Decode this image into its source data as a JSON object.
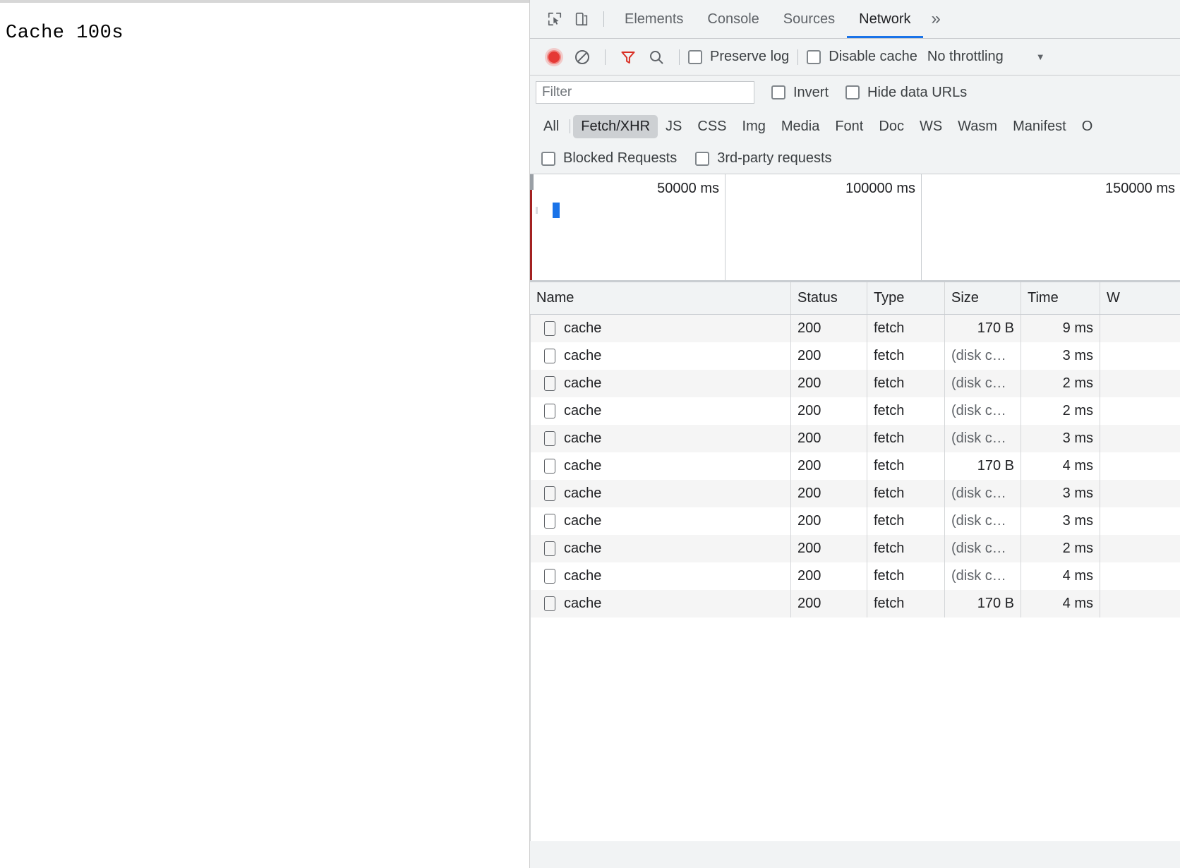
{
  "page": {
    "heading": "Cache 100s"
  },
  "devtools": {
    "tabs": [
      {
        "label": "Elements",
        "active": false
      },
      {
        "label": "Console",
        "active": false
      },
      {
        "label": "Sources",
        "active": false
      },
      {
        "label": "Network",
        "active": true
      }
    ],
    "more_tabs_label": "»",
    "icons": {
      "inspect": "inspect-element-icon",
      "device": "device-toolbar-icon",
      "record": "record-button-icon",
      "clear": "clear-icon",
      "filter": "filter-icon",
      "search": "search-icon"
    },
    "toolbar": {
      "preserve_log_label": "Preserve log",
      "preserve_log_checked": false,
      "disable_cache_label": "Disable cache",
      "disable_cache_checked": false,
      "throttling_label": "No throttling",
      "caret_glyph": "▼"
    },
    "filter": {
      "value": "",
      "placeholder": "Filter",
      "invert_label": "Invert",
      "invert_checked": false,
      "hide_data_urls_label": "Hide data URLs",
      "hide_data_urls_checked": false
    },
    "type_filters": [
      {
        "label": "All",
        "selected": false
      },
      {
        "label": "Fetch/XHR",
        "selected": true
      },
      {
        "label": "JS",
        "selected": false
      },
      {
        "label": "CSS",
        "selected": false
      },
      {
        "label": "Img",
        "selected": false
      },
      {
        "label": "Media",
        "selected": false
      },
      {
        "label": "Font",
        "selected": false
      },
      {
        "label": "Doc",
        "selected": false
      },
      {
        "label": "WS",
        "selected": false
      },
      {
        "label": "Wasm",
        "selected": false
      },
      {
        "label": "Manifest",
        "selected": false
      },
      {
        "label": "O",
        "selected": false
      }
    ],
    "request_options": {
      "blocked_requests_label": "Blocked Requests",
      "blocked_requests_checked": false,
      "third_party_label": "3rd-party requests",
      "third_party_checked": false
    },
    "overview": {
      "ticks": [
        "50000 ms",
        "100000 ms",
        "150000 ms"
      ],
      "marker_color": "#1a73e8",
      "event_line_color": "#a32121"
    },
    "table": {
      "columns": [
        "Name",
        "Status",
        "Type",
        "Size",
        "Time",
        "W"
      ],
      "rows": [
        {
          "name": "cache",
          "status": "200",
          "type": "fetch",
          "size": "170 B",
          "size_muted": false,
          "time": "9 ms"
        },
        {
          "name": "cache",
          "status": "200",
          "type": "fetch",
          "size": "(disk c…",
          "size_muted": true,
          "time": "3 ms"
        },
        {
          "name": "cache",
          "status": "200",
          "type": "fetch",
          "size": "(disk c…",
          "size_muted": true,
          "time": "2 ms"
        },
        {
          "name": "cache",
          "status": "200",
          "type": "fetch",
          "size": "(disk c…",
          "size_muted": true,
          "time": "2 ms"
        },
        {
          "name": "cache",
          "status": "200",
          "type": "fetch",
          "size": "(disk c…",
          "size_muted": true,
          "time": "3 ms"
        },
        {
          "name": "cache",
          "status": "200",
          "type": "fetch",
          "size": "170 B",
          "size_muted": false,
          "time": "4 ms"
        },
        {
          "name": "cache",
          "status": "200",
          "type": "fetch",
          "size": "(disk c…",
          "size_muted": true,
          "time": "3 ms"
        },
        {
          "name": "cache",
          "status": "200",
          "type": "fetch",
          "size": "(disk c…",
          "size_muted": true,
          "time": "3 ms"
        },
        {
          "name": "cache",
          "status": "200",
          "type": "fetch",
          "size": "(disk c…",
          "size_muted": true,
          "time": "2 ms"
        },
        {
          "name": "cache",
          "status": "200",
          "type": "fetch",
          "size": "(disk c…",
          "size_muted": true,
          "time": "4 ms"
        },
        {
          "name": "cache",
          "status": "200",
          "type": "fetch",
          "size": "170 B",
          "size_muted": false,
          "time": "4 ms"
        }
      ]
    },
    "colors": {
      "accent": "#1a73e8",
      "record": "#e53935",
      "filter_active": "#d93025",
      "panel_bg": "#f1f3f4",
      "row_alt": "#f5f5f5"
    }
  }
}
